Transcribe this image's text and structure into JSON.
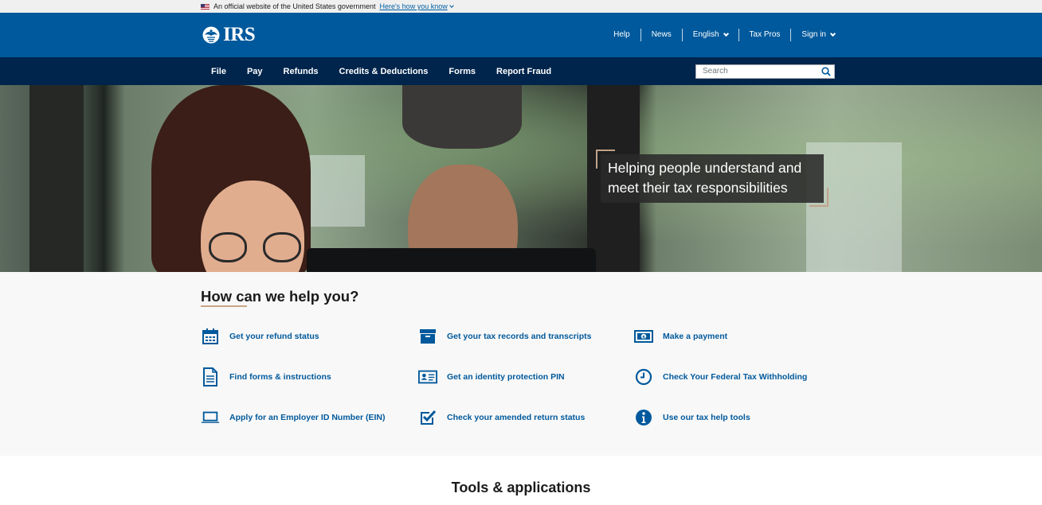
{
  "gov_banner": {
    "text": "An official website of the United States government",
    "link": "Here's how you know"
  },
  "header": {
    "logo_text": "IRS",
    "utility": [
      {
        "label": "Help"
      },
      {
        "label": "News"
      },
      {
        "label": "English"
      },
      {
        "label": "Tax Pros"
      },
      {
        "label": "Sign in"
      }
    ]
  },
  "nav": {
    "items": [
      "File",
      "Pay",
      "Refunds",
      "Credits & Deductions",
      "Forms",
      "Report Fraud"
    ],
    "search_placeholder": "Search"
  },
  "hero": {
    "caption": "Helping people understand and meet their tax responsibilities"
  },
  "help": {
    "title": "How can we help you?",
    "items": [
      {
        "label": "Get your refund status",
        "icon": "calendar-icon"
      },
      {
        "label": "Get your tax records and transcripts",
        "icon": "archive-box-icon"
      },
      {
        "label": "Make a payment",
        "icon": "dollar-bill-icon"
      },
      {
        "label": "Find forms & instructions",
        "icon": "document-icon"
      },
      {
        "label": "Get an identity protection PIN",
        "icon": "id-card-icon"
      },
      {
        "label": "Check Your Federal Tax Withholding",
        "icon": "clock-icon"
      },
      {
        "label": "Apply for an Employer ID Number (EIN)",
        "icon": "laptop-icon"
      },
      {
        "label": "Check your amended return status",
        "icon": "checkbox-icon"
      },
      {
        "label": "Use our tax help tools",
        "icon": "info-icon"
      }
    ]
  },
  "tools": {
    "title": "Tools & applications"
  },
  "colors": {
    "header_blue": "#00599c",
    "nav_navy": "#00254c",
    "link_blue": "#00599c",
    "accent_tan": "#c9a588"
  }
}
